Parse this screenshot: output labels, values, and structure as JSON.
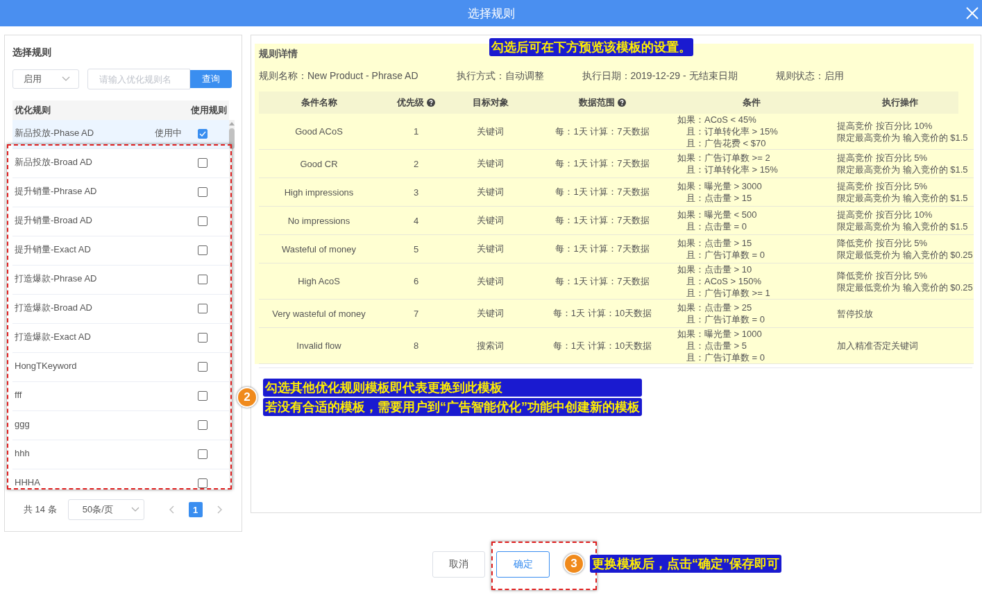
{
  "dialog": {
    "title": "选择规则"
  },
  "left_panel": {
    "title": "选择规则",
    "status_filter": "启用",
    "search": {
      "placeholder": "请输入优化规则名"
    },
    "search_button": "查询",
    "columns": [
      "优化规则",
      "使用规则"
    ],
    "rules": [
      {
        "name": "新品投放-Phase AD",
        "status": "使用中",
        "checked": true,
        "selected": true
      },
      {
        "name": "新品投放-Broad AD",
        "checked": false,
        "selected": false
      },
      {
        "name": "提升销量-Phrase AD",
        "checked": false,
        "selected": false
      },
      {
        "name": "提升销量-Broad AD",
        "checked": false,
        "selected": false
      },
      {
        "name": "提升销量-Exact AD",
        "checked": false,
        "selected": false
      },
      {
        "name": "打造爆款-Phrase AD",
        "checked": false,
        "selected": false
      },
      {
        "name": "打造爆款-Broad AD",
        "checked": false,
        "selected": false
      },
      {
        "name": "打造爆款-Exact AD",
        "checked": false,
        "selected": false
      },
      {
        "name": "HongTKeyword",
        "checked": false,
        "selected": false
      },
      {
        "name": "fff",
        "checked": false,
        "selected": false
      },
      {
        "name": "ggg",
        "checked": false,
        "selected": false
      },
      {
        "name": "hhh",
        "checked": false,
        "selected": false
      },
      {
        "name": "HHHA",
        "checked": false,
        "selected": false
      }
    ],
    "pagination": {
      "total": "共 14 条",
      "page_size": "50条/页",
      "pages": [
        {
          "label": "1",
          "selected": true
        }
      ]
    }
  },
  "detail": {
    "title": "规则详情",
    "meta": [
      "规则名称：New Product - Phrase AD",
      "执行方式：自动调整",
      "执行日期：2019-12-29 - 无结束日期",
      "规则状态：启用"
    ],
    "columns": [
      {
        "label": "条件名称",
        "help": false
      },
      {
        "label": "优先级",
        "help": true
      },
      {
        "label": "目标对象",
        "help": false
      },
      {
        "label": "数据范围",
        "help": true
      },
      {
        "label": "条件",
        "help": false
      },
      {
        "label": "执行操作",
        "help": false
      }
    ],
    "rows": [
      {
        "name": "Good ACoS",
        "priority": "1",
        "target": "关键词",
        "range": "每：1天 计算：7天数据",
        "conditions": [
          "如果：ACoS < 45%",
          "且：订单转化率 > 15%",
          "且：广告花费 < $70"
        ],
        "actions": [
          "提高竞价 按百分比 10%",
          "限定最高竞价为 输入竞价的 $1.5"
        ]
      },
      {
        "name": "Good CR",
        "priority": "2",
        "target": "关键词",
        "range": "每：1天 计算：7天数据",
        "conditions": [
          "如果：广告订单数 >= 2",
          "且：订单转化率 > 15%"
        ],
        "actions": [
          "提高竞价 按百分比 5%",
          "限定最高竞价为 输入竞价的 $1.5"
        ]
      },
      {
        "name": "High impressions",
        "priority": "3",
        "target": "关键词",
        "range": "每：1天 计算：7天数据",
        "conditions": [
          "如果：曝光量 > 3000",
          "且：点击量 > 15"
        ],
        "actions": [
          "提高竞价 按百分比 5%",
          "限定最高竞价为 输入竞价的 $1.5"
        ]
      },
      {
        "name": "No impressions",
        "priority": "4",
        "target": "关键词",
        "range": "每：1天 计算：7天数据",
        "conditions": [
          "如果：曝光量 < 500",
          "且：点击量 = 0"
        ],
        "actions": [
          "提高竞价 按百分比 10%",
          "限定最高竞价为 输入竞价的 $1.5"
        ]
      },
      {
        "name": "Wasteful of money",
        "priority": "5",
        "target": "关键词",
        "range": "每：1天 计算：7天数据",
        "conditions": [
          "如果：点击量 > 15",
          "且：广告订单数 = 0"
        ],
        "actions": [
          "降低竞价 按百分比 5%",
          "限定最低竞价为 输入竞价的 $0.25"
        ]
      },
      {
        "name": "High AcoS",
        "priority": "6",
        "target": "关键词",
        "range": "每：1天 计算：7天数据",
        "conditions": [
          "如果：点击量 > 10",
          "且：ACoS > 150%",
          "且：广告订单数 >= 1"
        ],
        "actions": [
          "降低竞价 按百分比 5%",
          "限定最低竞价为 输入竞价的 $0.25"
        ]
      },
      {
        "name": "Very wasteful of money",
        "priority": "7",
        "target": "关键词",
        "range": "每：1天 计算：10天数据",
        "conditions": [
          "如果：点击量 > 25",
          "且：广告订单数 = 0"
        ],
        "actions": [
          "暂停投放"
        ]
      },
      {
        "name": "Invalid flow",
        "priority": "8",
        "target": "搜索词",
        "range": "每：1天 计算：10天数据",
        "conditions": [
          "如果：曝光量 > 1000",
          "且：点击量 > 5",
          "且：广告订单数 = 0"
        ],
        "actions": [
          "加入精准否定关键词"
        ]
      }
    ]
  },
  "footer": {
    "cancel": "取消",
    "confirm": "确定"
  },
  "annotations": [
    {
      "lines": [
        "勾选后可在下方预览该模板的设置。"
      ]
    },
    {
      "number": "2",
      "lines": [
        "勾选其他优化规则模板即代表更换到此模板",
        "若没有合适的模板，需要用户到“广告智能优化”功能中创建新的模板"
      ]
    },
    {
      "number": "3",
      "lines": [
        "更换模板后，点击“确定”保存即可"
      ]
    }
  ]
}
